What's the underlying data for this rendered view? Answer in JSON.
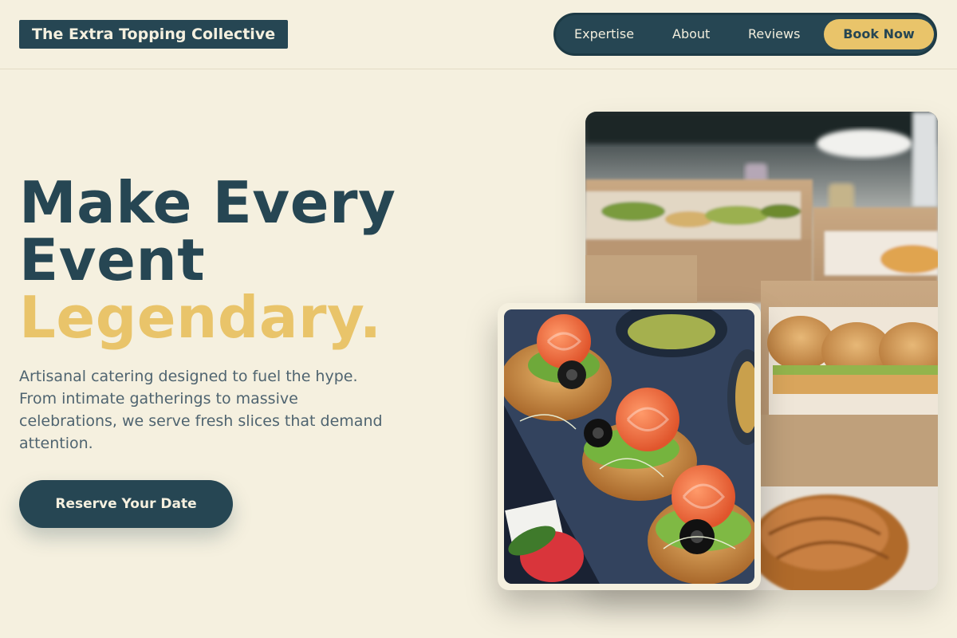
{
  "header": {
    "logo": "The Extra Topping Collective",
    "nav": [
      {
        "label": "Expertise"
      },
      {
        "label": "About"
      },
      {
        "label": "Reviews"
      }
    ],
    "cta_label": "Book Now"
  },
  "hero": {
    "headline_line1": "Make Every",
    "headline_line2": "Event",
    "headline_accent": "Legendary.",
    "subtext": "Artisanal catering designed to fuel the hype. From intimate gatherings to massive celebrations, we serve fresh slices that demand attention.",
    "cta_label": "Reserve Your Date"
  },
  "colors": {
    "background": "#f5f0df",
    "primary": "#264653",
    "accent": "#e9c46a",
    "text_muted": "#4f6470"
  }
}
